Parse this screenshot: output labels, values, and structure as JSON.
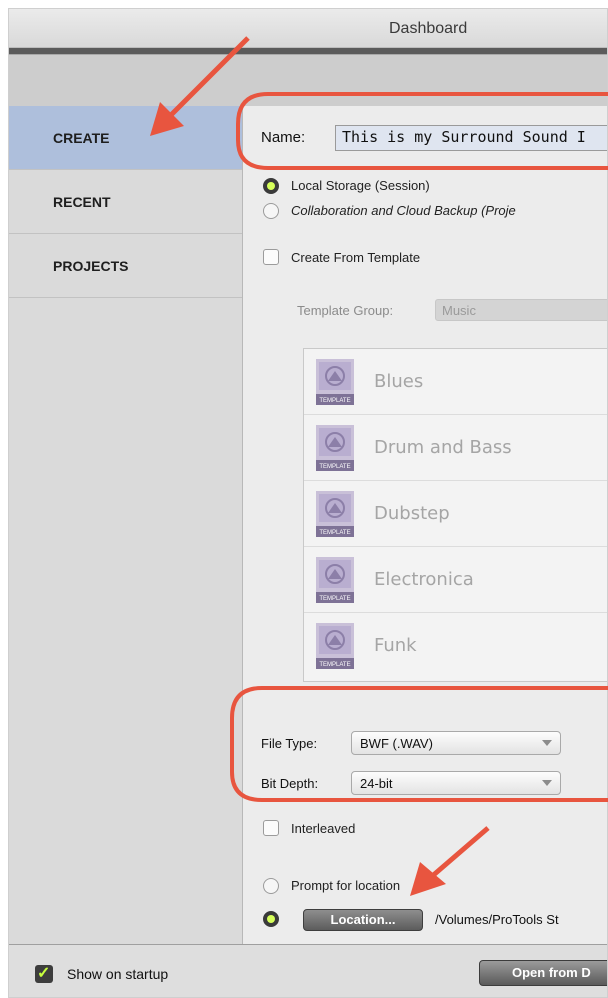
{
  "window": {
    "title": "Dashboard"
  },
  "sidebar": {
    "items": [
      {
        "label": "CREATE",
        "active": true
      },
      {
        "label": "RECENT",
        "active": false
      },
      {
        "label": "PROJECTS",
        "active": false
      }
    ]
  },
  "create": {
    "name_label": "Name:",
    "name_value": "This is my Surround Sound I",
    "storage_options": [
      {
        "label": "Local Storage (Session)",
        "selected": true
      },
      {
        "label": "Collaboration and Cloud Backup (Proje",
        "selected": false
      }
    ],
    "create_from_template_label": "Create From Template",
    "template_group_label": "Template Group:",
    "template_group_value": "Music",
    "templates": [
      {
        "name": "Blues",
        "icon": "template-icon",
        "icon_text": "TEMPLATE"
      },
      {
        "name": "Drum and Bass",
        "icon": "template-icon",
        "icon_text": "TEMPLATE"
      },
      {
        "name": "Dubstep",
        "icon": "template-icon",
        "icon_text": "TEMPLATE"
      },
      {
        "name": "Electronica",
        "icon": "template-icon",
        "icon_text": "TEMPLATE"
      },
      {
        "name": "Funk",
        "icon": "template-icon",
        "icon_text": "TEMPLATE"
      }
    ],
    "file_type_label": "File Type:",
    "file_type_value": "BWF (.WAV)",
    "bit_depth_label": "Bit Depth:",
    "bit_depth_value": "24-bit",
    "interleaved_label": "Interleaved",
    "prompt_location_label": "Prompt for location",
    "location_button_label": "Location...",
    "location_path": "/Volumes/ProTools St"
  },
  "footer": {
    "show_on_startup_label": "Show on startup",
    "open_button_label": "Open from D"
  },
  "annotations": {
    "color": "#e8553f"
  },
  "colors": {
    "active_nav": "#aebfdc",
    "radio_active": "#d6ff5a"
  }
}
